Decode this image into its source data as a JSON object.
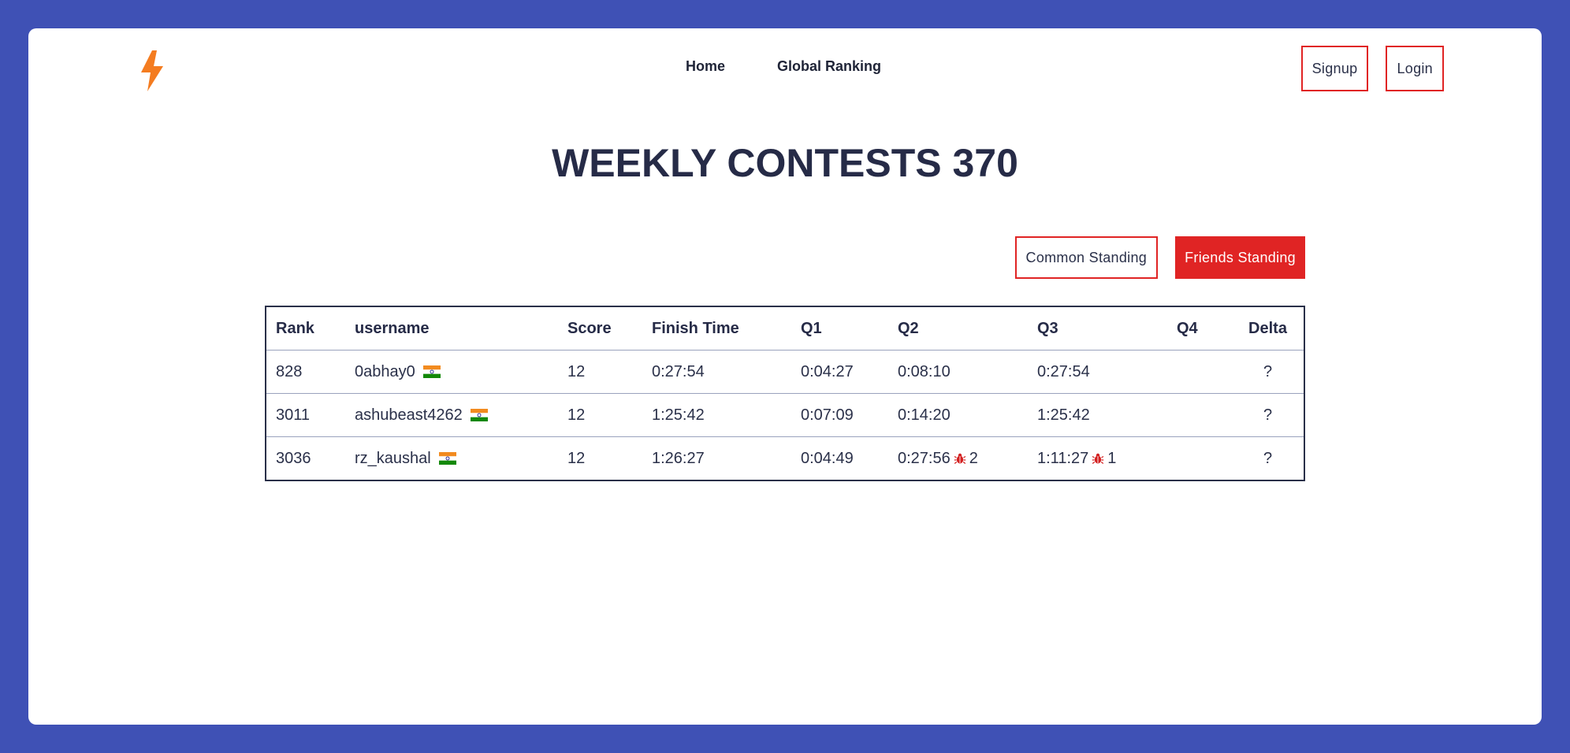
{
  "nav": {
    "home": "Home",
    "global_ranking": "Global Ranking"
  },
  "auth": {
    "signup": "Signup",
    "login": "Login"
  },
  "page_title": "WEEKLY CONTESTS 370",
  "standing": {
    "common": "Common Standing",
    "friends": "Friends Standing"
  },
  "colors": {
    "background": "#3f51b5",
    "accent": "#e02424",
    "logo": "#f47c20"
  },
  "table": {
    "headers": [
      "Rank",
      "username",
      "Score",
      "Finish Time",
      "Q1",
      "Q2",
      "Q3",
      "Q4",
      "Delta"
    ],
    "rows": [
      {
        "rank": "828",
        "username": "0abhay0",
        "flag": "india-flag-icon",
        "score": "12",
        "finish": "0:27:54",
        "q1": "0:04:27",
        "q2": "0:08:10",
        "q2_pen": "",
        "q3": "0:27:54",
        "q3_pen": "",
        "q4": "",
        "delta": "?"
      },
      {
        "rank": "3011",
        "username": "ashubeast4262",
        "flag": "india-flag-icon",
        "score": "12",
        "finish": "1:25:42",
        "q1": "0:07:09",
        "q2": "0:14:20",
        "q2_pen": "",
        "q3": "1:25:42",
        "q3_pen": "",
        "q4": "",
        "delta": "?"
      },
      {
        "rank": "3036",
        "username": "rz_kaushal",
        "flag": "india-flag-icon",
        "score": "12",
        "finish": "1:26:27",
        "q1": "0:04:49",
        "q2": "0:27:56",
        "q2_pen": "2",
        "q3": "1:11:27",
        "q3_pen": "1",
        "q4": "",
        "delta": "?"
      }
    ]
  }
}
